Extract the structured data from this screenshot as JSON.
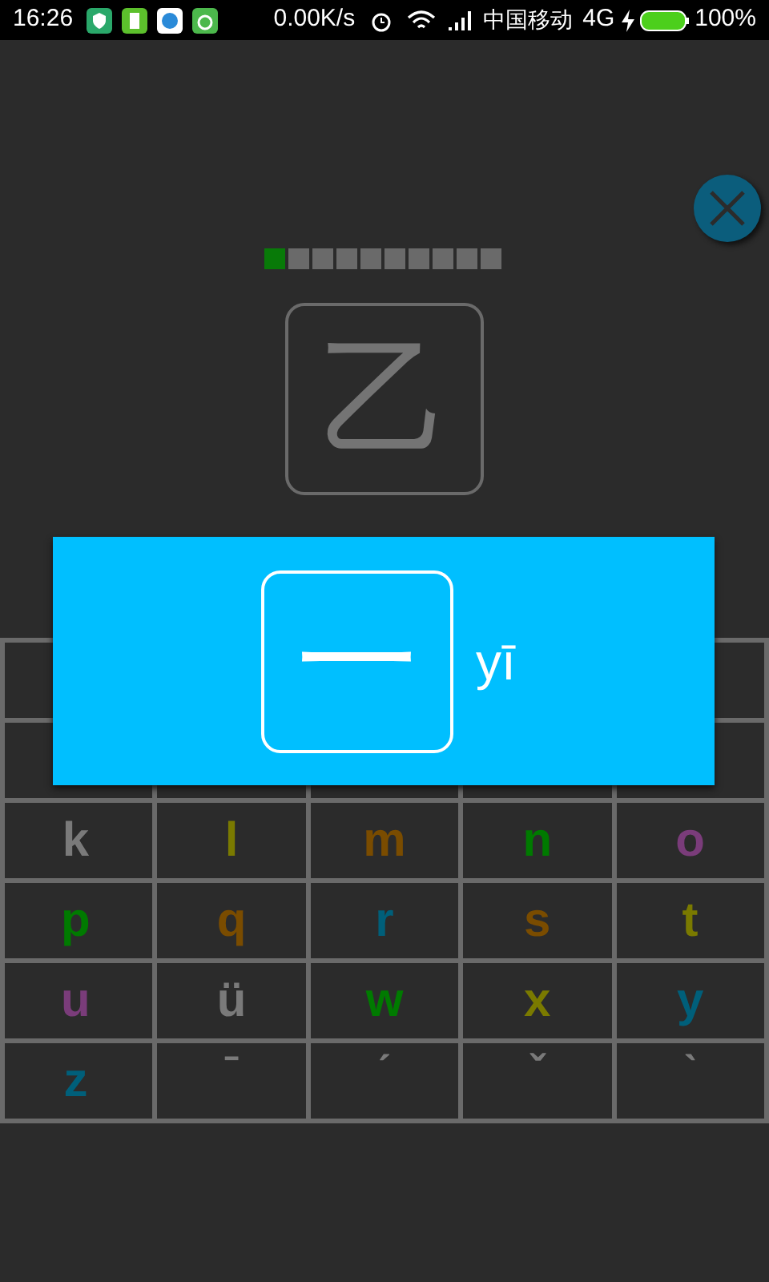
{
  "status_bar": {
    "time": "16:26",
    "net_speed": "0.00K/s",
    "carrier": "中国移动",
    "network": "4G",
    "battery": "100%"
  },
  "progress": [
    {
      "done": true
    },
    {
      "done": false
    },
    {
      "done": false
    },
    {
      "done": false
    },
    {
      "done": false
    },
    {
      "done": false
    },
    {
      "done": false
    },
    {
      "done": false
    },
    {
      "done": false
    },
    {
      "done": false
    }
  ],
  "character": "乙",
  "popup": {
    "character": "一",
    "pinyin": "yī"
  },
  "keys": [
    {
      "label": "k",
      "color": "#7a7a7a"
    },
    {
      "label": "l",
      "color": "#7a7a00"
    },
    {
      "label": "m",
      "color": "#7a4c00"
    },
    {
      "label": "n",
      "color": "#007a00"
    },
    {
      "label": "o",
      "color": "#7a3c7a"
    },
    {
      "label": "p",
      "color": "#007a00"
    },
    {
      "label": "q",
      "color": "#7a4c00"
    },
    {
      "label": "r",
      "color": "#005f7a"
    },
    {
      "label": "s",
      "color": "#7a4c00"
    },
    {
      "label": "t",
      "color": "#7a7a00"
    },
    {
      "label": "u",
      "color": "#7a3c7a"
    },
    {
      "label": "ü",
      "color": "#7a7a7a"
    },
    {
      "label": "w",
      "color": "#007a00"
    },
    {
      "label": "x",
      "color": "#7a7a00"
    },
    {
      "label": "y",
      "color": "#005f7a"
    },
    {
      "label": "z",
      "color": "#005f7a"
    },
    {
      "label": "ˉ",
      "color": "#7a7a7a",
      "kind": "tone"
    },
    {
      "label": "ˊ",
      "color": "#7a7a7a",
      "kind": "tone"
    },
    {
      "label": "ˇ",
      "color": "#7a7a7a",
      "kind": "tone"
    },
    {
      "label": "ˋ",
      "color": "#7a7a7a",
      "kind": "tone"
    }
  ]
}
